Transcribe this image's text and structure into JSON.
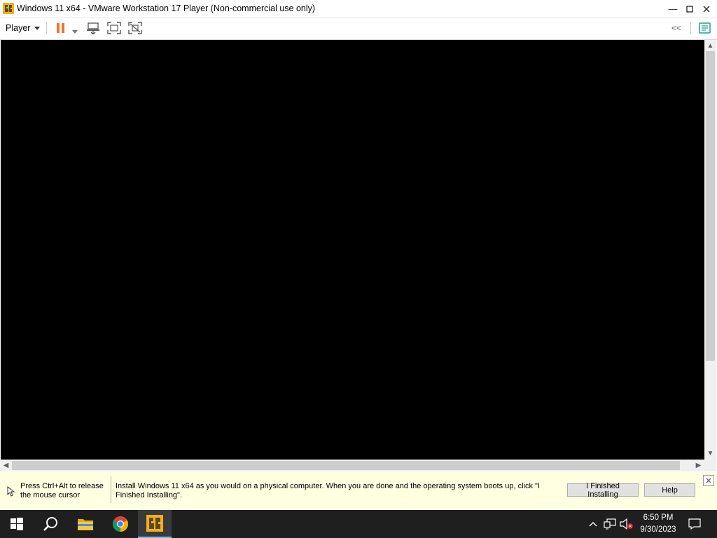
{
  "window": {
    "title": "Windows 11 x64 - VMware Workstation 17 Player (Non-commercial use only)",
    "icon": "vmware-player-icon"
  },
  "toolbar": {
    "player_menu_label": "Player",
    "collapse_label": "<<"
  },
  "message_bar": {
    "release_hint": "Press Ctrl+Alt to release the mouse cursor",
    "install_message": "Install Windows 11 x64 as you would on a physical computer. When you are done and the operating system boots up, click \"I Finished Installing\".",
    "finished_button": "I Finished Installing",
    "help_button": "Help"
  },
  "taskbar": {
    "time": "6:50 PM",
    "date": "9/30/2023",
    "apps": [
      "start-icon",
      "search-icon",
      "file-explorer-icon",
      "chrome-icon",
      "vmware-player-icon"
    ]
  },
  "colors": {
    "pause_orange": "#e8772e",
    "message_bg": "#ffffe1",
    "taskbar_bg": "#1f1f1f",
    "vm_screen": "#000000"
  }
}
